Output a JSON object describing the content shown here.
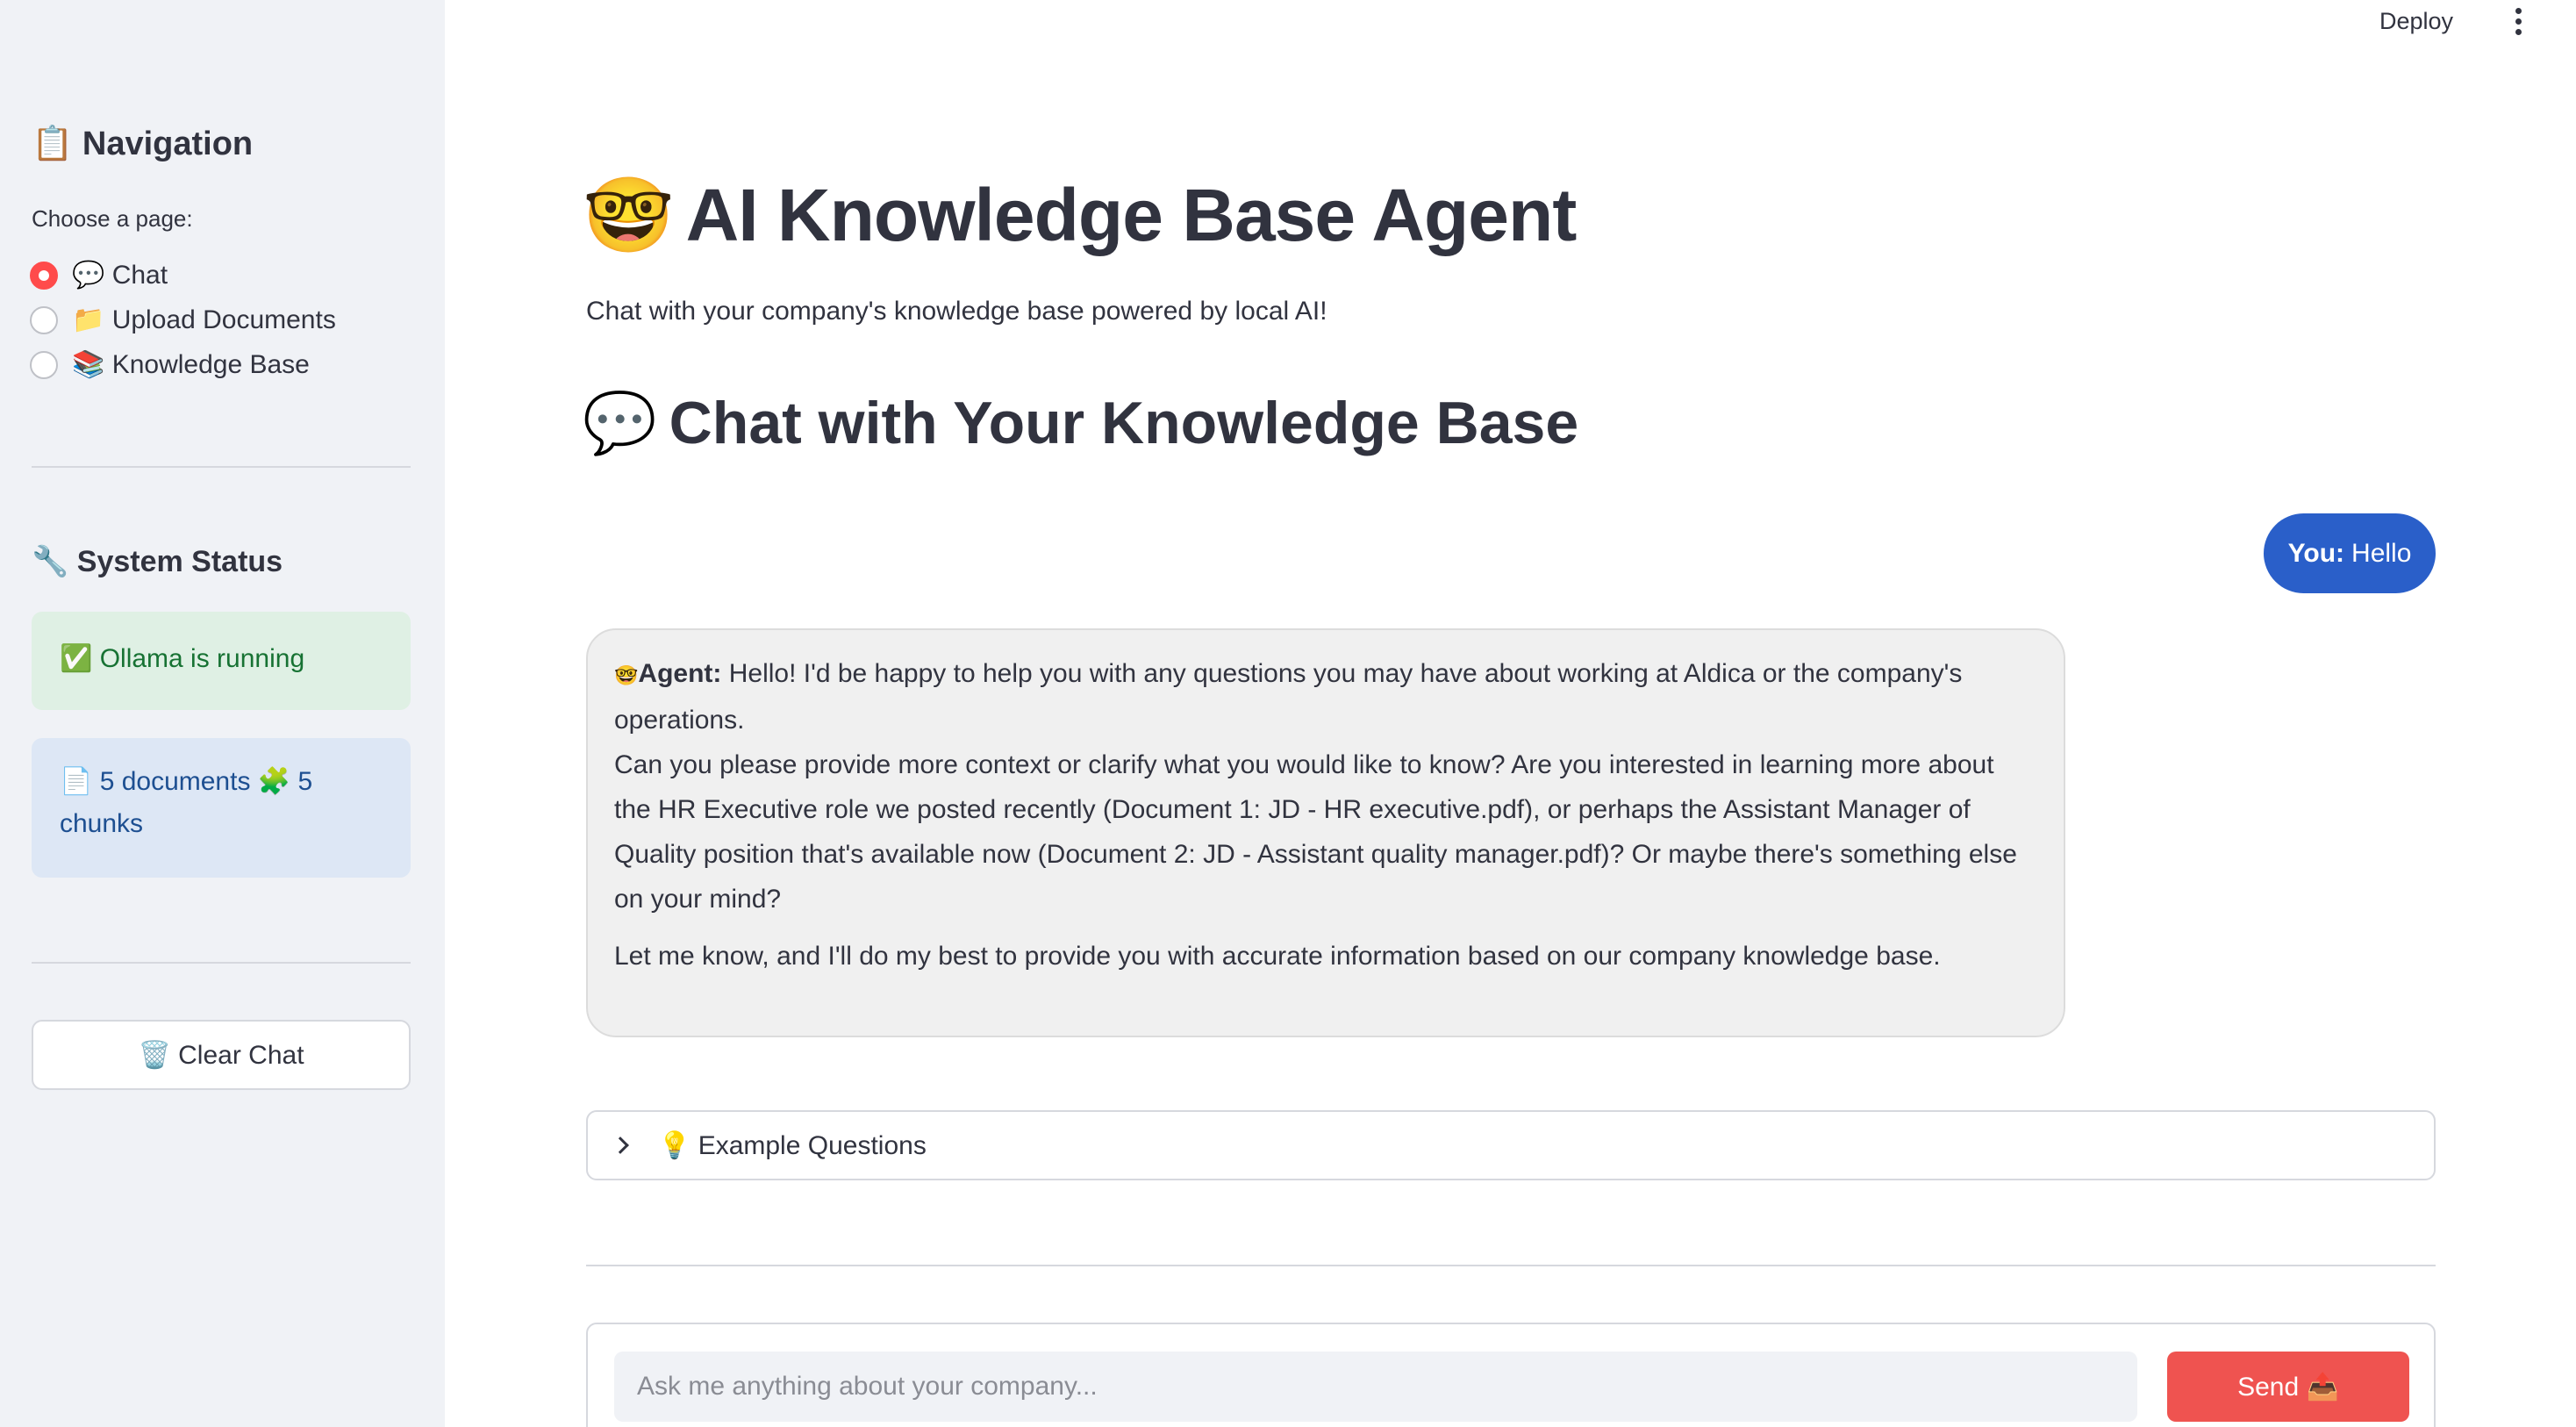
{
  "topbar": {
    "deploy_label": "Deploy",
    "menu_icon": "kebab-menu-icon"
  },
  "sidebar": {
    "nav_title": "📋 Navigation",
    "choose_label": "Choose a page:",
    "pages": [
      {
        "label": "💬 Chat",
        "selected": true
      },
      {
        "label": "📁 Upload Documents",
        "selected": false
      },
      {
        "label": "📚 Knowledge Base",
        "selected": false
      }
    ],
    "status_title": "🔧 System Status",
    "status_ok": "✅ Ollama is running",
    "status_docs": "📄 5 documents 🧩 5 chunks",
    "clear_button": "🗑️ Clear Chat"
  },
  "main": {
    "title": "AI Knowledge Base Agent",
    "title_icon": "🤓",
    "subtitle": "Chat with your company's knowledge base powered by local AI!",
    "section_title": "Chat with Your Knowledge Base",
    "section_icon": "💬",
    "messages": {
      "user_label": "You:",
      "user_text": "Hello",
      "agent_label": "Agent:",
      "agent_icon": "🤓",
      "agent_para1": "Hello! I'd be happy to help you with any questions you may have about working at Aldica or the company's operations.",
      "agent_para2": "Can you please provide more context or clarify what you would like to know? Are you interested in learning more about the HR Executive role we posted recently (Document 1: JD - HR executive.pdf), or perhaps the Assistant Manager of Quality position that's available now (Document 2: JD - Assistant quality manager.pdf)? Or maybe there's something else on your mind?",
      "agent_para3": "Let me know, and I'll do my best to provide you with accurate information based on our company knowledge base."
    },
    "expander_label": "💡 Example Questions",
    "input": {
      "placeholder": "Ask me anything about your company...",
      "value": ""
    },
    "send_label": "Send 📤"
  },
  "colors": {
    "accent": "#ff4b4b",
    "user_bubble": "#2a5fc9",
    "send_button": "#ef5350",
    "sidebar_bg": "#f0f2f6"
  }
}
